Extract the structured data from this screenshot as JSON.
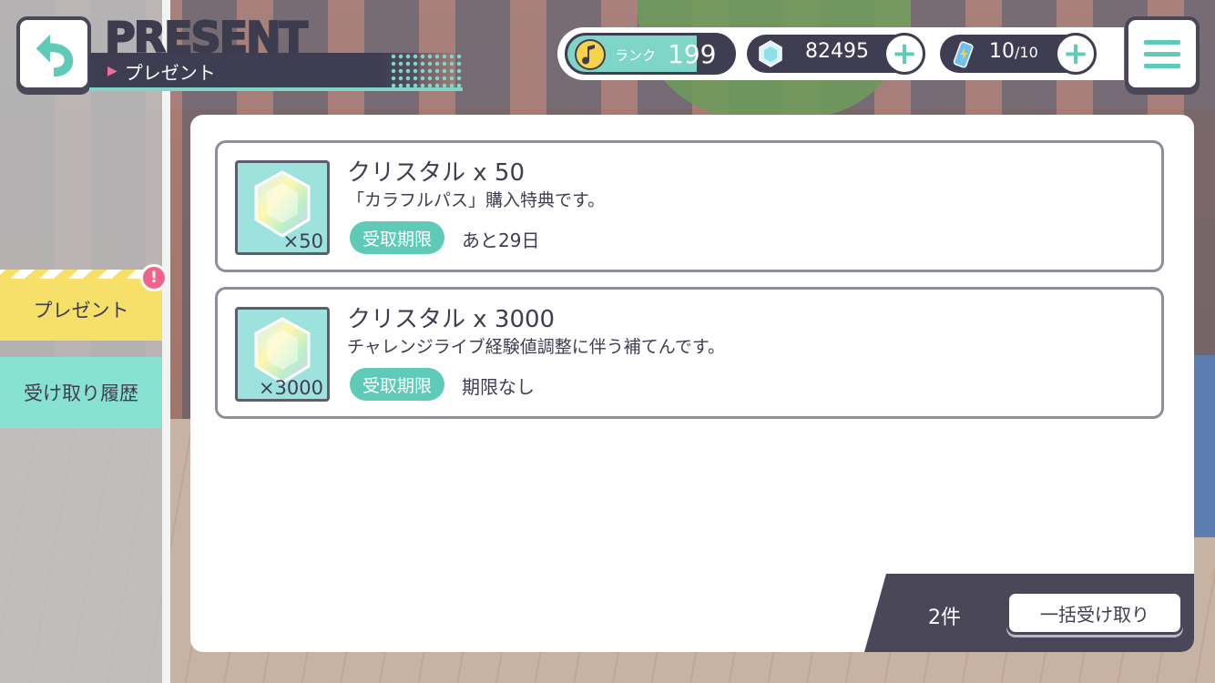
{
  "header": {
    "title_en": "PRESENT",
    "title_jp": "プレゼント",
    "back_icon": "back-arrow-icon",
    "menu_icon": "hamburger-menu-icon"
  },
  "status": {
    "rank_label": "ランク",
    "rank_value": "199",
    "rank_progress": 0.78,
    "crystals": "82495",
    "energy_current": "10",
    "energy_max": "/10"
  },
  "sidebar": {
    "items": [
      {
        "label": "プレゼント",
        "active": true,
        "badge": "!"
      },
      {
        "label": "受け取り履歴",
        "active": false
      }
    ]
  },
  "presents": [
    {
      "name": "クリスタル x 50",
      "description": "「カラフルパス」購入特典です。",
      "qty": "×50",
      "deadline_label": "受取期限",
      "deadline_value": "あと29日"
    },
    {
      "name": "クリスタル x 3000",
      "description": "チャレンジライブ経験値調整に伴う補てんです。",
      "qty": "×3000",
      "deadline_label": "受取期限",
      "deadline_value": "期限なし"
    }
  ],
  "footer": {
    "count": "2件",
    "claim_all": "一括受け取り"
  },
  "colors": {
    "accent": "#5fcab8",
    "dark": "#3e3d52",
    "tab_active": "#f7e06a",
    "tab_inactive": "#88e2d2",
    "badge": "#f06489"
  }
}
